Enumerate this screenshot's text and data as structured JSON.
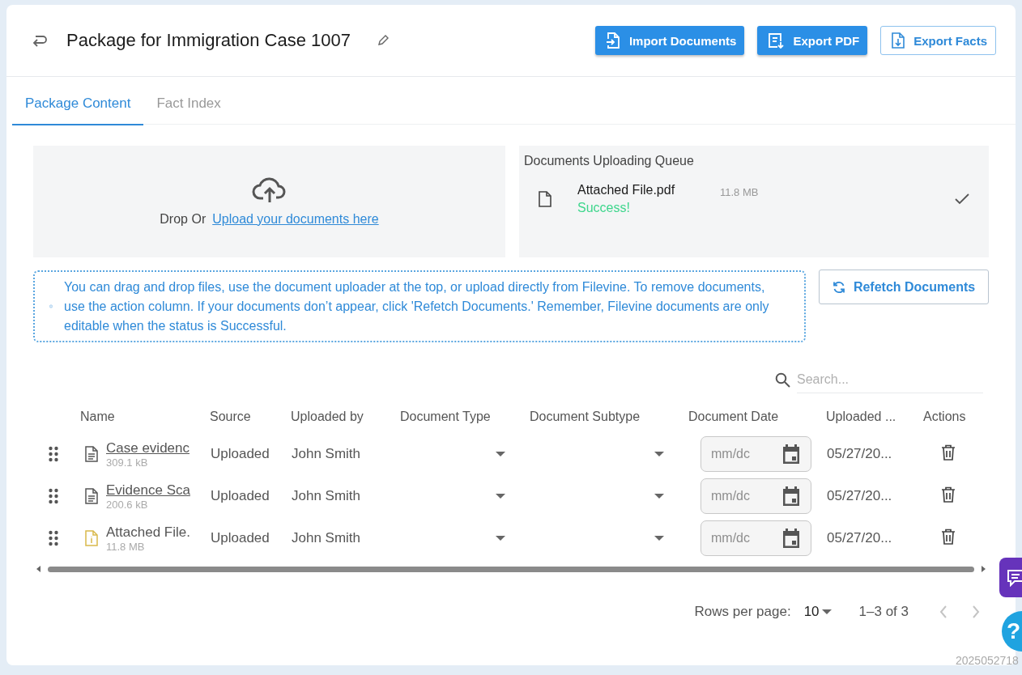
{
  "header": {
    "title": "Package for Immigration Case 1007",
    "buttons": [
      {
        "label": "Import Documents",
        "kind": "primary"
      },
      {
        "label": "Export PDF",
        "kind": "primary"
      },
      {
        "label": "Export Facts",
        "kind": "outline"
      }
    ]
  },
  "tabs": [
    {
      "label": "Package Content",
      "selected": true
    },
    {
      "label": "Fact Index",
      "selected": false
    }
  ],
  "upload": {
    "prompt": "Drop Or",
    "link": "Upload your documents here"
  },
  "queue": {
    "title": "Documents Uploading Queue",
    "items": [
      {
        "name": "Attached File.pdf",
        "size": "11.8 MB",
        "status": "Success!",
        "done": true
      }
    ]
  },
  "notice": {
    "text": "You can drag and drop files, use the document uploader at the top, or upload directly from Filevine. To remove documents, use the action column. If your documents don’t appear, click 'Refetch Documents.' Remember, Filevine documents are only editable when the status is Successful.",
    "button": "Refetch Documents"
  },
  "search": {
    "placeholder": "Search..."
  },
  "table": {
    "columns": [
      "Name",
      "Source",
      "Uploaded by",
      "Document Type",
      "Document Subtype",
      "Document Date",
      "Uploaded ...",
      "Actions"
    ],
    "rows": [
      {
        "name": "Case evidenc",
        "linked": true,
        "kind": "document",
        "size": "309.1 kB",
        "source": "Uploaded",
        "uploaded_by": "John Smith",
        "date_placeholder": "mm/dc",
        "uploaded": "05/27/20..."
      },
      {
        "name": "Evidence Sca",
        "linked": true,
        "kind": "document",
        "size": "200.6 kB",
        "source": "Uploaded",
        "uploaded_by": "John Smith",
        "date_placeholder": "mm/dc",
        "uploaded": "05/27/20..."
      },
      {
        "name": "Attached File.",
        "linked": false,
        "kind": "info",
        "size": "11.8 MB",
        "source": "Uploaded",
        "uploaded_by": "John Smith",
        "date_placeholder": "mm/dc",
        "uploaded": "05/27/20..."
      }
    ]
  },
  "pagination": {
    "label": "Rows per page:",
    "rows_per_page": "10",
    "range": "1–3 of 3",
    "prev_disabled": true,
    "next_disabled": true
  },
  "help": {
    "label": "?"
  },
  "version": "2025052718"
}
